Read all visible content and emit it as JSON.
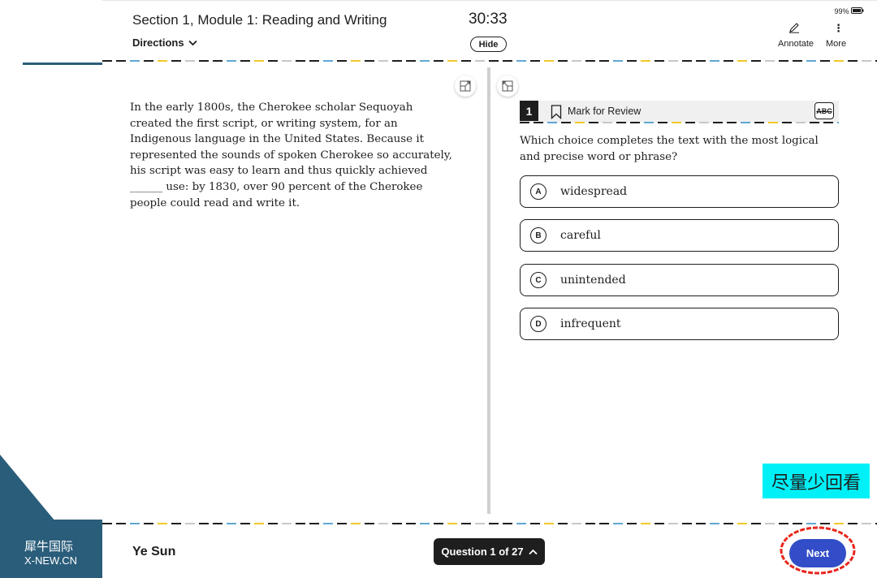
{
  "watermark": {
    "cn": "犀牛国际",
    "en": "X-NEW.CN"
  },
  "header": {
    "section_title": "Section 1, Module 1: Reading and Writing",
    "directions_label": "Directions",
    "timer": "30:33",
    "hide_label": "Hide",
    "battery": "99%",
    "annotate_label": "Annotate",
    "more_label": "More"
  },
  "passage": {
    "text": "In the early 1800s, the Cherokee scholar Sequoyah created the first script, or writing system, for an Indigenous language in the United States. Because it represented the sounds of spoken Cherokee so accurately, his script was easy to learn and thus quickly achieved ______ use: by 1830, over 90 percent of the Cherokee people could read and write it."
  },
  "question": {
    "number": "1",
    "mark_for_review": "Mark for Review",
    "abc_label": "ABC",
    "prompt": "Which choice completes the text with the most logical and precise word or phrase?",
    "choices": [
      {
        "letter": "A",
        "text": "widespread"
      },
      {
        "letter": "B",
        "text": "careful"
      },
      {
        "letter": "C",
        "text": "unintended"
      },
      {
        "letter": "D",
        "text": "infrequent"
      }
    ]
  },
  "annotation_note": "尽量少回看",
  "footer": {
    "user_name": "Ye Sun",
    "question_nav": "Question 1 of 27",
    "next_label": "Next"
  },
  "colors": {
    "accent_blue": "#324dc7",
    "dash_blue": "#5fa8d3",
    "dash_yellow": "#f0c929",
    "dash_dark": "#1e1e1e",
    "highlight_cyan": "#00f0f8",
    "circle_red": "#e8261c",
    "watermark_teal": "#2a5d7a"
  }
}
